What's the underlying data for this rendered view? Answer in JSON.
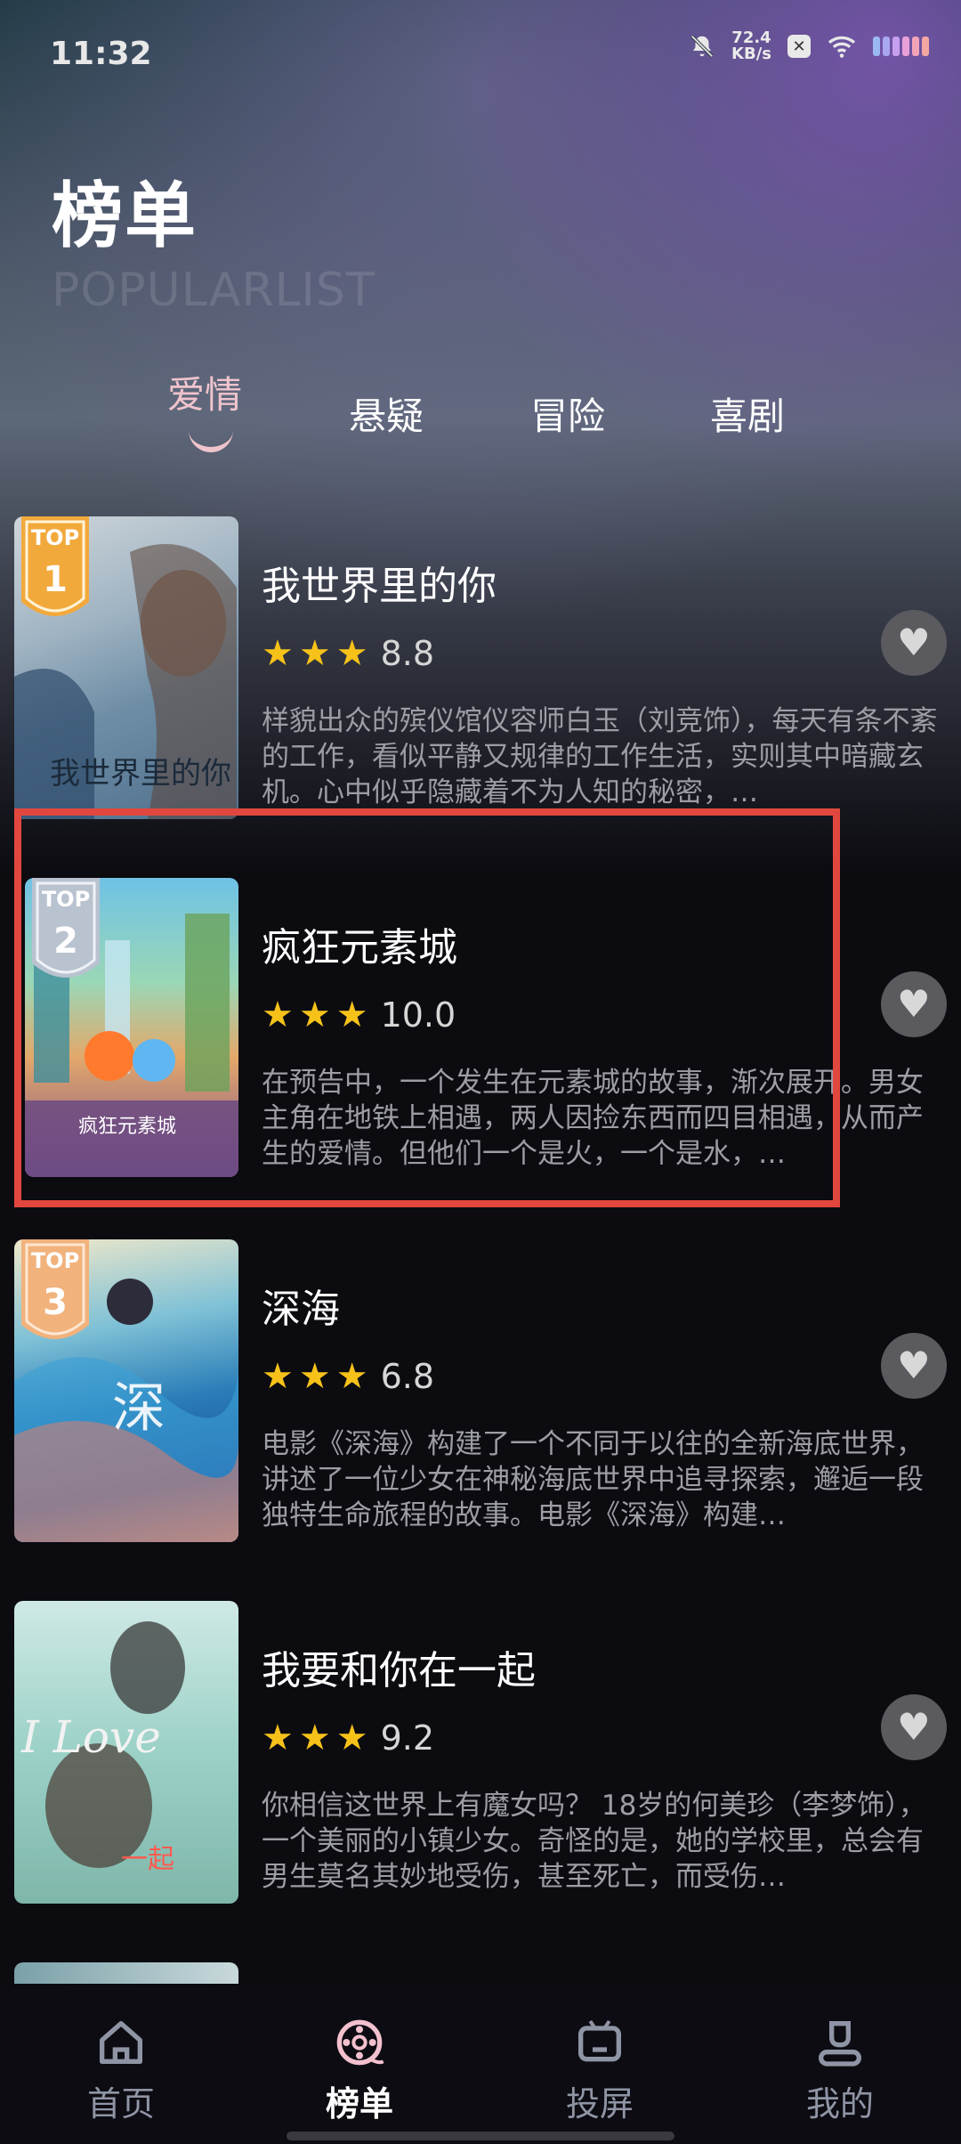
{
  "status_bar": {
    "time": "11:32",
    "net_speed_value": "72.4",
    "net_speed_unit": "KB/s",
    "icons": [
      "bell-muted-icon",
      "x-app-icon",
      "wifi-icon",
      "battery-icon"
    ]
  },
  "header": {
    "title": "榜单",
    "subtitle": "POPULARLIST"
  },
  "tabs": [
    {
      "label": "爱情",
      "active": true
    },
    {
      "label": "悬疑",
      "active": false
    },
    {
      "label": "冒险",
      "active": false
    },
    {
      "label": "喜剧",
      "active": false
    }
  ],
  "movies": [
    {
      "rank_label": "TOP",
      "rank": "1",
      "title": "我世界里的你",
      "score": "8.8",
      "description": "样貌出众的殡仪馆仪容师白玉（刘竞饰），每天有条不紊的工作，看似平静又规律的工作生活，实则其中暗藏玄机。心中似乎隐藏着不为人知的秘密，…"
    },
    {
      "rank_label": "TOP",
      "rank": "2",
      "title": "疯狂元素城",
      "score": "10.0",
      "description": "在预告中，一个发生在元素城的故事，渐次展开。男女主角在地铁上相遇，两人因捡东西而四目相遇，从而产生的爱情。但他们一个是火，一个是水，…"
    },
    {
      "rank_label": "TOP",
      "rank": "3",
      "title": "深海",
      "score": "6.8",
      "description": "电影《深海》构建了一个不同于以往的全新海底世界，讲述了一位少女在神秘海底世界中追寻探索，邂逅一段独特生命旅程的故事。电影《深海》构建…"
    },
    {
      "rank_label": "",
      "rank": "",
      "title": "我要和你在一起",
      "score": "9.2",
      "description": "你相信这世界上有魔女吗？ 18岁的何美珍（李梦饰），一个美丽的小镇少女。奇怪的是，她的学校里，总会有男生莫名其妙地受伤，甚至死亡，而受伤…"
    }
  ],
  "bottom_nav": [
    {
      "label": "首页",
      "icon": "home-icon",
      "active": false
    },
    {
      "label": "榜单",
      "icon": "film-reel-icon",
      "active": true
    },
    {
      "label": "投屏",
      "icon": "tv-icon",
      "active": false
    },
    {
      "label": "我的",
      "icon": "profile-icon",
      "active": false
    }
  ],
  "colors": {
    "accent_pink": "#f0c4cd",
    "star": "#f6c21a",
    "highlight_border": "#e2473f",
    "background": "#0b0b10"
  }
}
